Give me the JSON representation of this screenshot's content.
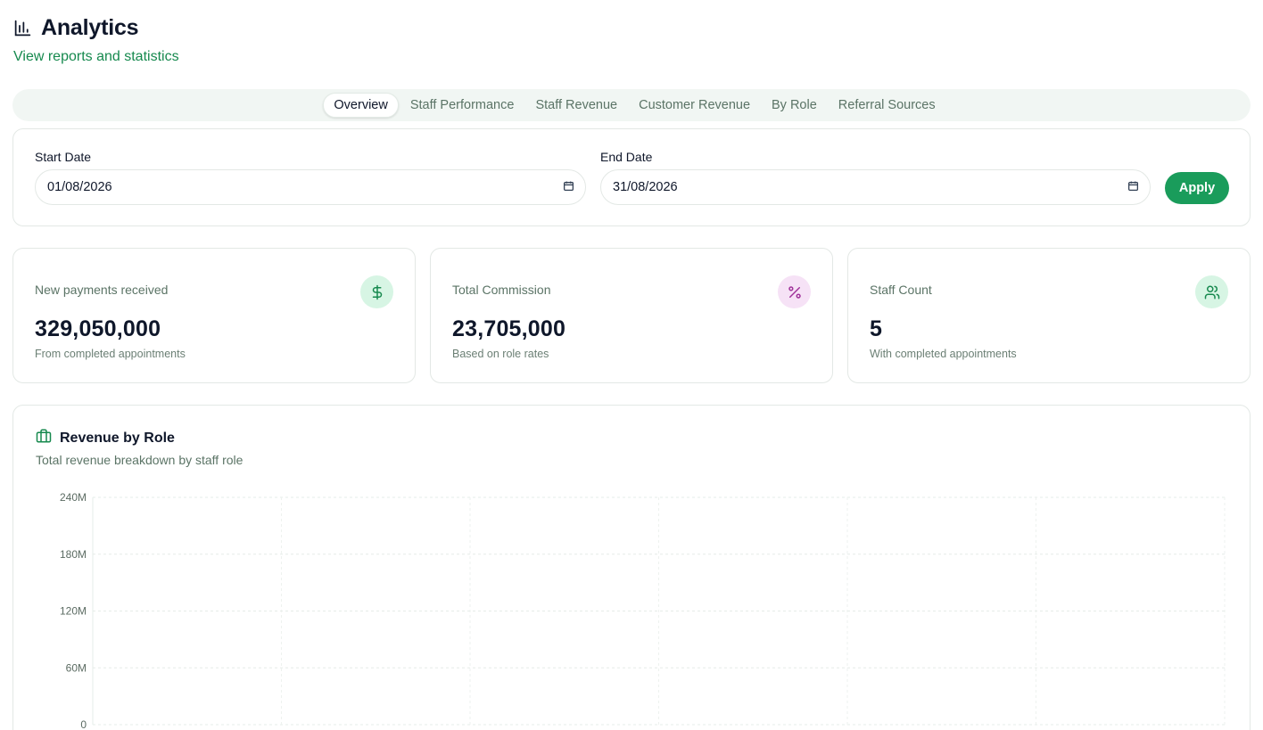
{
  "header": {
    "icon": "bar-chart-icon",
    "title": "Analytics",
    "subtitle": "View reports and statistics"
  },
  "tabs": [
    {
      "label": "Overview",
      "active": true
    },
    {
      "label": "Staff Performance",
      "active": false
    },
    {
      "label": "Staff Revenue",
      "active": false
    },
    {
      "label": "Customer Revenue",
      "active": false
    },
    {
      "label": "By Role",
      "active": false
    },
    {
      "label": "Referral Sources",
      "active": false
    }
  ],
  "filters": {
    "start_label": "Start Date",
    "start_value": "01/08/2026",
    "end_label": "End Date",
    "end_value": "31/08/2026",
    "calendar_icon": "calendar-icon",
    "apply_label": "Apply"
  },
  "stats": [
    {
      "label": "New payments received",
      "value": "329,050,000",
      "note": "From completed appointments",
      "icon": "dollar-icon",
      "icon_color": "#16894e",
      "icon_bg": "#d7f5e4"
    },
    {
      "label": "Total Commission",
      "value": "23,705,000",
      "note": "Based on role rates",
      "icon": "percent-icon",
      "icon_color": "#a0329a",
      "icon_bg": "#f6e2f6"
    },
    {
      "label": "Staff Count",
      "value": "5",
      "note": "With completed appointments",
      "icon": "users-icon",
      "icon_color": "#16894e",
      "icon_bg": "#d7f5e4"
    }
  ],
  "revenue_by_role": {
    "icon": "briefcase-icon",
    "title": "Revenue by Role",
    "subtitle": "Total revenue breakdown by staff role"
  },
  "chart_data": {
    "type": "bar",
    "title": "Revenue by Role",
    "subtitle": "Total revenue breakdown by staff role",
    "y_ticks": [
      "0",
      "60M",
      "120M",
      "180M",
      "240M"
    ],
    "ylim": [
      0,
      240000000
    ],
    "grid": true,
    "categories": [],
    "values": []
  },
  "colors": {
    "accent": "#1a9c5b",
    "subtitle_green": "#16894e",
    "tab_bar_bg": "#f1f6f3"
  }
}
